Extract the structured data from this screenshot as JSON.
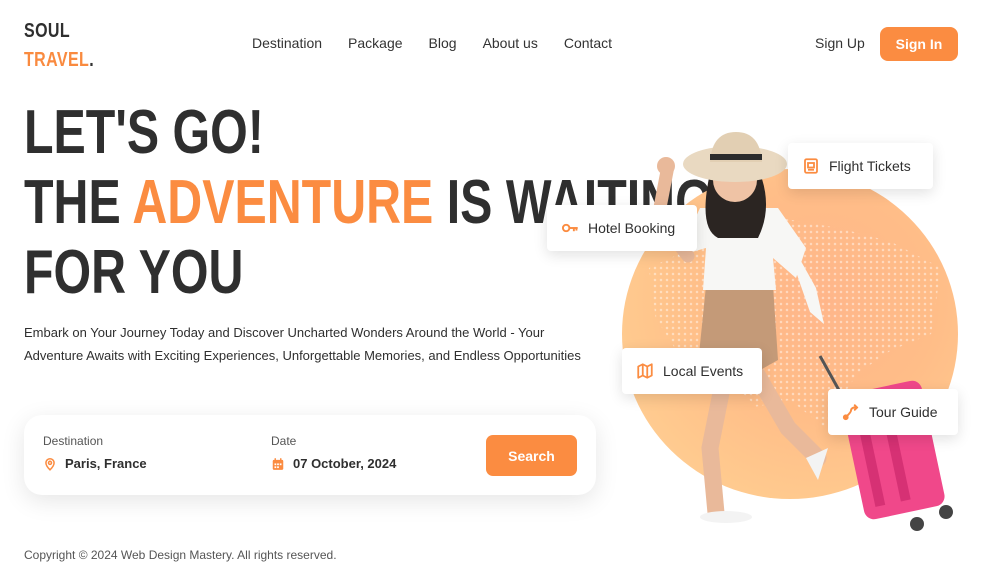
{
  "logo": {
    "line1": "SOUL",
    "line2": "TRAVEL",
    "dot": "."
  },
  "nav": [
    "Destination",
    "Package",
    "Blog",
    "About us",
    "Contact"
  ],
  "auth": {
    "signup": "Sign Up",
    "signin": "Sign In"
  },
  "hero": {
    "line1": "LET'S GO!",
    "line2_pre": "THE ",
    "line2_accent": "ADVENTURE",
    "line2_post": " IS WAITING",
    "line3": "FOR YOU",
    "description": "Embark on Your Journey Today and Discover Uncharted Wonders Around the World - Your Adventure Awaits with Exciting Experiences, Unforgettable Memories, and Endless Opportunities"
  },
  "search": {
    "destination_label": "Destination",
    "destination_value": "Paris, France",
    "date_label": "Date",
    "date_value": "07 October, 2024",
    "button": "Search"
  },
  "chips": {
    "flight": "Flight Tickets",
    "hotel": "Hotel Booking",
    "events": "Local Events",
    "guide": "Tour Guide"
  },
  "footer": {
    "copyright": "Copyright © 2024 Web Design Mastery. All rights reserved."
  },
  "colors": {
    "accent": "#fb8c41",
    "text": "#2f2f2f"
  },
  "icons": {
    "destination": "location-pin-icon",
    "date": "calendar-icon",
    "flight": "ticket-icon",
    "hotel": "key-icon",
    "events": "map-icon",
    "guide": "route-icon"
  }
}
